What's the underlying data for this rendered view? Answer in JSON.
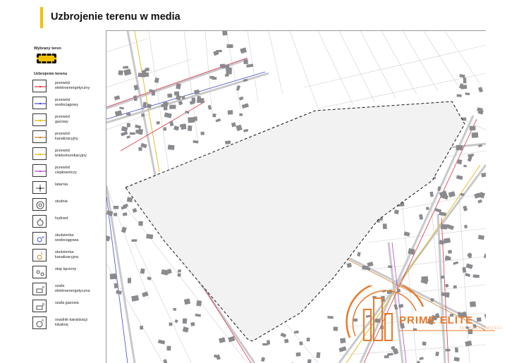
{
  "title": "Uzbrojenie terenu w media",
  "legend": {
    "selected_header": "Wybrany teren",
    "utilities_header": "Uzbrojenie terenu",
    "items": [
      {
        "label": "przewód\nelektroenergetyczny",
        "color": "#e0344a",
        "icon": "red-line-icon"
      },
      {
        "label": "przewód\nwodociągowy",
        "color": "#3f48cc",
        "icon": "blue-line-icon"
      },
      {
        "label": "przewód\ngazowy",
        "color": "#d9b400",
        "icon": "yellow-line-icon"
      },
      {
        "label": "przewód\nkanalizacyjny",
        "color": "#c97a2c",
        "icon": "brown-line-icon"
      },
      {
        "label": "przewód\ntelekomunikacyjny",
        "color": "#e0b400",
        "icon": "orange-line-icon"
      },
      {
        "label": "przewód\nciepłowniczy",
        "color": "#b044c8",
        "icon": "purple-line-icon"
      },
      {
        "label": "latarnia",
        "color": "#222222",
        "icon": "lamp-icon"
      },
      {
        "label": "studnia",
        "color": "#222222",
        "icon": "well-icon"
      },
      {
        "label": "hydrant",
        "color": "#222222",
        "icon": "hydrant-icon"
      },
      {
        "label": "studzienka\nwodociągowa",
        "color": "#3f48cc",
        "icon": "water-manhole-icon"
      },
      {
        "label": "studzienka\nkanalizacyjna",
        "color": "#c97a2c",
        "icon": "sewer-manhole-icon"
      },
      {
        "label": "słup łączony",
        "color": "#222222",
        "icon": "pole-icon"
      },
      {
        "label": "szafa\nelektroenergetyczna",
        "color": "#222222",
        "icon": "power-cabinet-icon"
      },
      {
        "label": "szafa gazowa",
        "color": "#222222",
        "icon": "gas-cabinet-icon"
      },
      {
        "label": "osadnik kanalizacji\nlokalnej",
        "color": "#222222",
        "icon": "septic-tank-icon"
      }
    ]
  },
  "map": {
    "background": "#ffffff",
    "parcel_fill": "#f2f2f2",
    "parcel_border": "#111111",
    "building_color": "#8a8a8f",
    "road_color": "#c9c9cc"
  },
  "logo": {
    "text": "PRIME ELITE",
    "subtext": "NIERUCHOMOŚCI",
    "color": "#e87a2a"
  }
}
